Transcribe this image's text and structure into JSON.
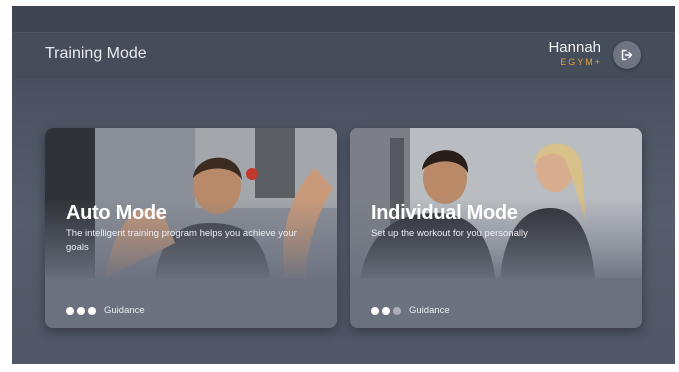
{
  "header": {
    "title": "Training Mode",
    "user_name": "Hannah",
    "brand": "EGYM+",
    "logout_icon": "logout-icon"
  },
  "cards": [
    {
      "title": "Auto Mode",
      "description": "The intelligent training program helps you achieve your goals",
      "guidance_label": "Guidance",
      "guidance_level": 3,
      "guidance_max": 3
    },
    {
      "title": "Individual Mode",
      "description": "Set up the workout for you personally",
      "guidance_label": "Guidance",
      "guidance_level": 2,
      "guidance_max": 3
    }
  ],
  "colors": {
    "background": "#4b5261",
    "card": "#6b717f",
    "brand": "#e0a040"
  }
}
